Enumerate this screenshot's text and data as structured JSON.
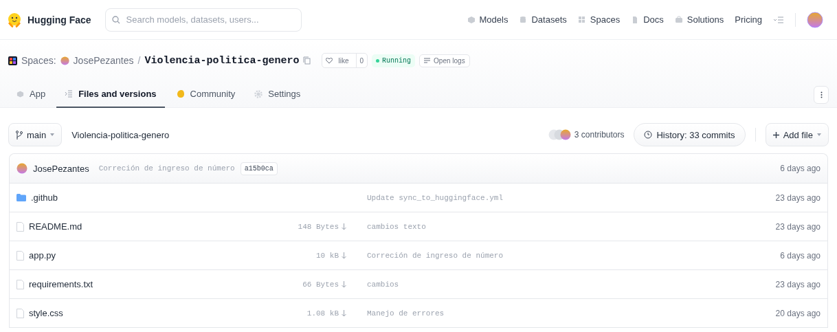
{
  "header": {
    "brand": "Hugging Face",
    "search": {
      "placeholder": "Search models, datasets, users..."
    },
    "nav": [
      {
        "label": "Models"
      },
      {
        "label": "Datasets"
      },
      {
        "label": "Spaces"
      },
      {
        "label": "Docs"
      },
      {
        "label": "Solutions"
      },
      {
        "label": "Pricing"
      }
    ]
  },
  "space": {
    "section": "Spaces:",
    "owner": "JosePezantes",
    "separator": "/",
    "name": "Violencia-politica-genero",
    "like_label": "like",
    "like_count": "0",
    "status": "Running",
    "logs": "Open logs"
  },
  "tabs": [
    {
      "label": "App",
      "selected": false
    },
    {
      "label": "Files and versions",
      "selected": true
    },
    {
      "label": "Community",
      "selected": false
    },
    {
      "label": "Settings",
      "selected": false
    }
  ],
  "repo": {
    "branch": "main",
    "path": "Violencia-politica-genero",
    "contributors": "3 contributors",
    "history": "History: 33 commits",
    "add_file": "Add file"
  },
  "last_commit": {
    "author": "JosePezantes",
    "message": "Correción de ingreso de número",
    "hash": "a15b0ca",
    "time": "6 days ago"
  },
  "files": [
    {
      "kind": "folder",
      "name": ".github",
      "message": "Update sync_to_huggingface.yml",
      "time": "23 days ago"
    },
    {
      "kind": "file",
      "name": "README.md",
      "size": "148 Bytes",
      "message": "cambios texto",
      "time": "23 days ago"
    },
    {
      "kind": "file",
      "name": "app.py",
      "size": "10 kB",
      "message": "Correción de ingreso de número",
      "time": "6 days ago"
    },
    {
      "kind": "file",
      "name": "requirements.txt",
      "size": "66 Bytes",
      "message": "cambios",
      "time": "23 days ago"
    },
    {
      "kind": "file",
      "name": "style.css",
      "size": "1.08 kB",
      "message": "Manejo de errores",
      "time": "20 days ago"
    }
  ]
}
